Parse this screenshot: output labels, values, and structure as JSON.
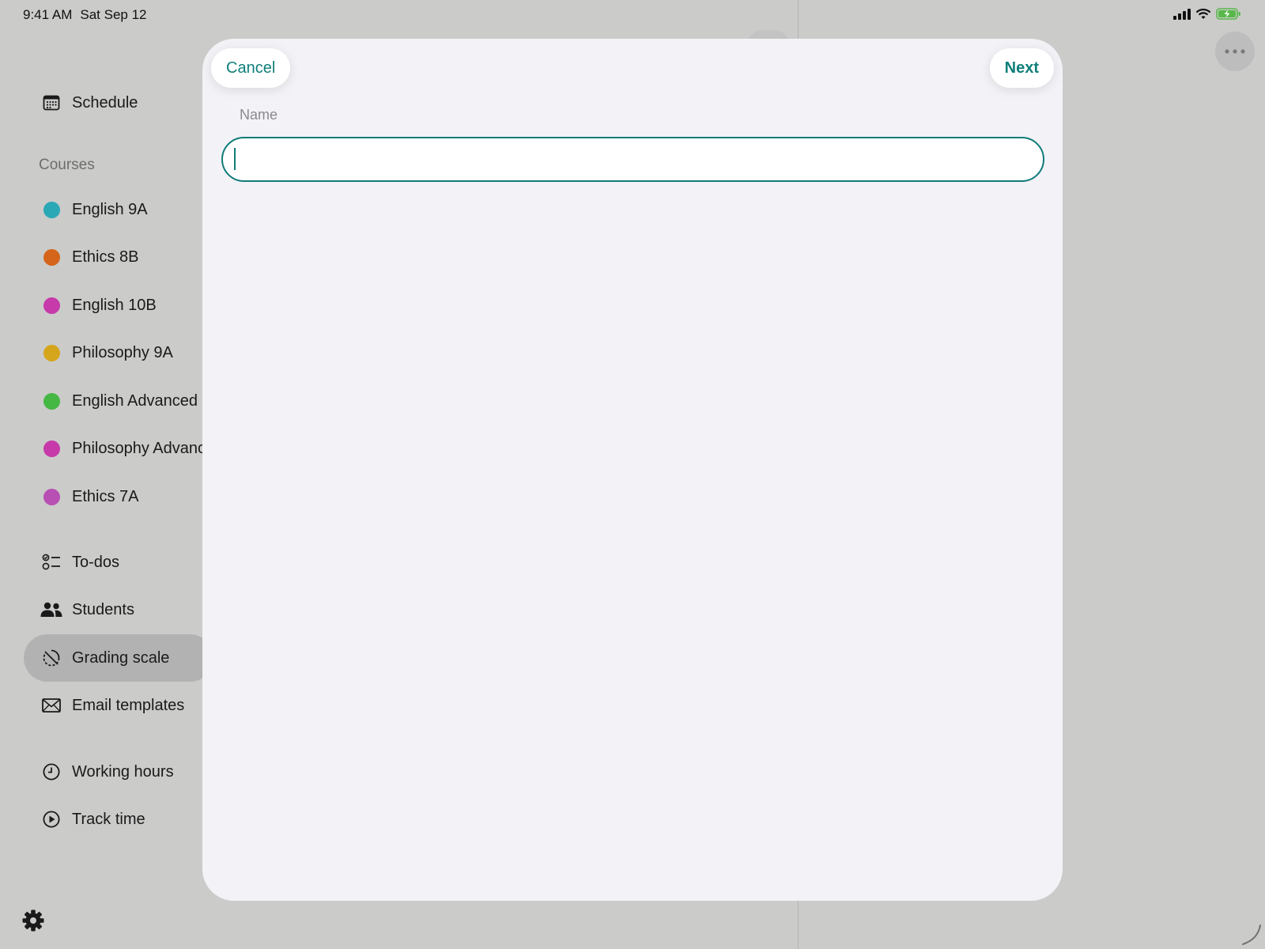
{
  "status_bar": {
    "time": "9:41 AM",
    "date": "Sat Sep 12",
    "icons": [
      "signal-icon",
      "wifi-icon",
      "battery-charging-icon"
    ]
  },
  "sidebar": {
    "top_items": [
      {
        "label": "Schedule",
        "icon": "calendar-icon"
      }
    ],
    "courses_title": "Courses",
    "courses": [
      {
        "label": "English 9A",
        "color": "#2aa8b6"
      },
      {
        "label": "Ethics 8B",
        "color": "#d5651a"
      },
      {
        "label": "English 10B",
        "color": "#c63aa9"
      },
      {
        "label": "Philosophy 9A",
        "color": "#d5a51b"
      },
      {
        "label": "English Advanced",
        "color": "#45b743"
      },
      {
        "label": "Philosophy Advanc",
        "color": "#c63aa9"
      },
      {
        "label": "Ethics 7A",
        "color": "#b84fb3"
      }
    ],
    "tools": [
      {
        "label": "To-dos",
        "icon": "checklist-icon"
      },
      {
        "label": "Students",
        "icon": "people-icon"
      },
      {
        "label": "Grading scale",
        "icon": "grading-scale-icon",
        "selected": true
      },
      {
        "label": "Email templates",
        "icon": "envelope-icon"
      }
    ],
    "time_items": [
      {
        "label": "Working hours",
        "icon": "clock-icon"
      },
      {
        "label": "Track time",
        "icon": "play-circle-icon"
      }
    ],
    "settings_icon": "gear-icon"
  },
  "modal": {
    "cancel_label": "Cancel",
    "next_label": "Next",
    "name_label": "Name",
    "name_value": ""
  },
  "colors": {
    "accent": "#0f7f7a",
    "sheet_background": "#f2f2f7",
    "dimmed_background": "#cbcbca"
  }
}
